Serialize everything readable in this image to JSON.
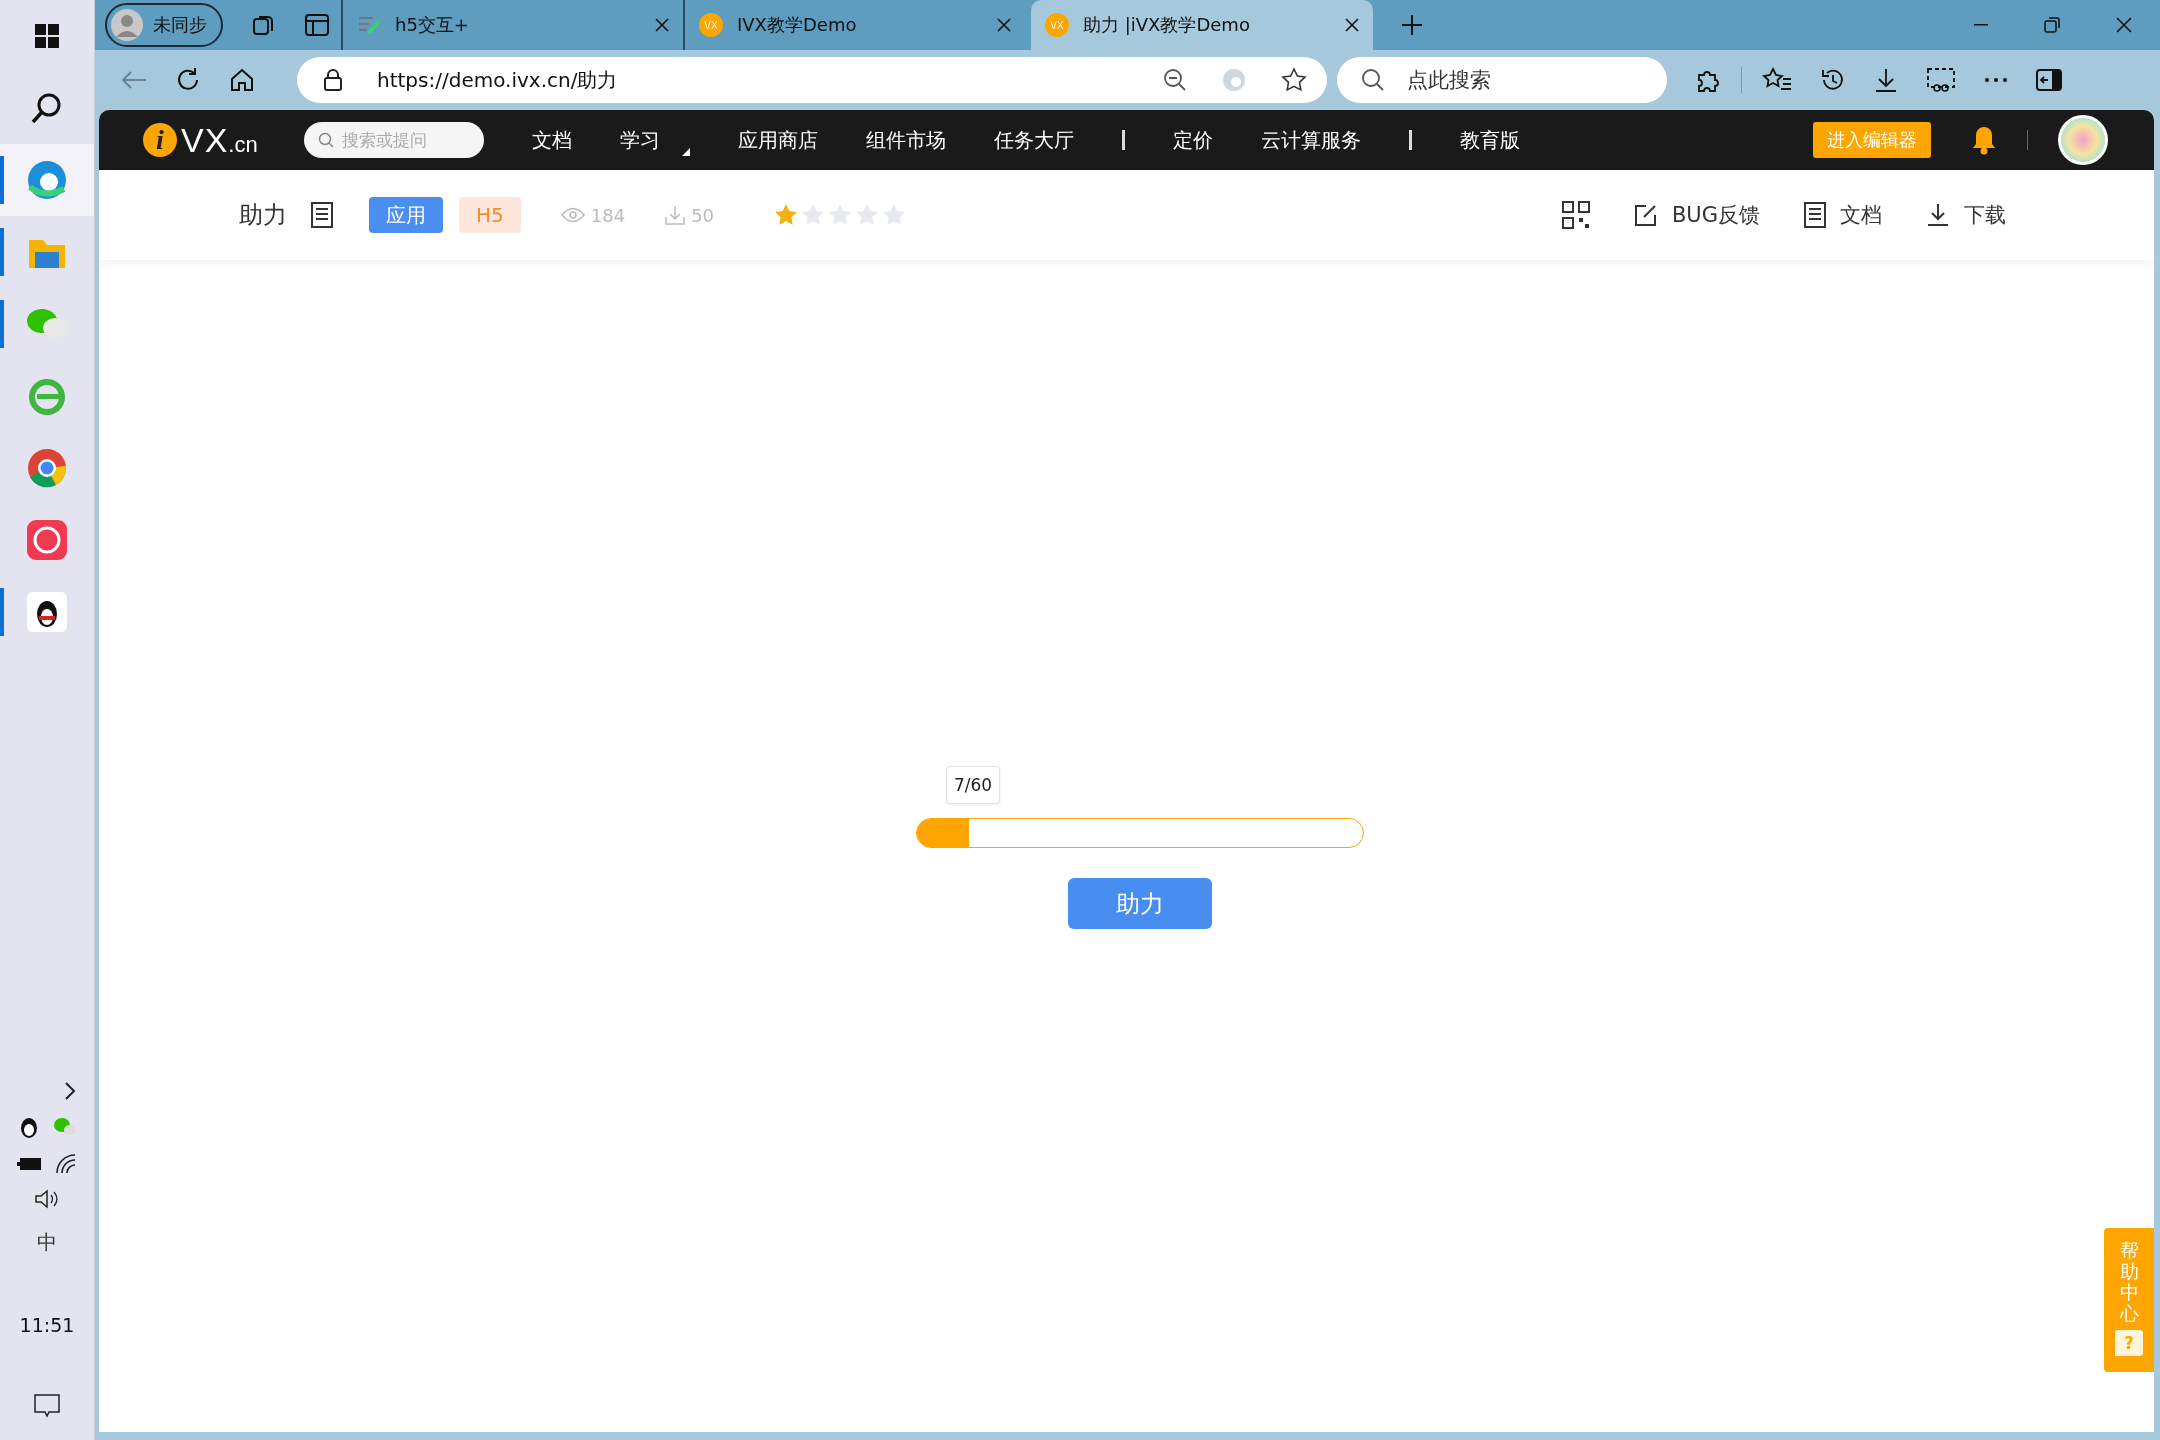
{
  "taskbar": {
    "apps": [
      {
        "running": false,
        "selected": false
      },
      {
        "running": false,
        "selected": false
      },
      {
        "running": true,
        "selected": true
      },
      {
        "running": true,
        "selected": false
      },
      {
        "running": true,
        "selected": false
      },
      {
        "running": false,
        "selected": false
      },
      {
        "running": false,
        "selected": false
      },
      {
        "running": false,
        "selected": false
      },
      {
        "running": true,
        "selected": false
      }
    ],
    "tray": {
      "ime": "中",
      "time": "11:51"
    }
  },
  "browser": {
    "profile": "未同步",
    "tabs": [
      {
        "title": "h5交互+",
        "selected": false
      },
      {
        "title": "IVX教学Demo",
        "favicon": "VX",
        "selected": false
      },
      {
        "title": "助力 |iVX教学Demo",
        "favicon": "VX",
        "selected": true
      }
    ],
    "address": "https://demo.ivx.cn/助力",
    "search_placeholder": "点此搜索"
  },
  "site_nav": {
    "logo": {
      "mark": "i",
      "name": "VX",
      "suffix": ".cn"
    },
    "search_placeholder": "搜索或提问",
    "items": [
      {
        "label": "文档",
        "kind": "link"
      },
      {
        "label": "学习",
        "kind": "menu"
      },
      {
        "label": "应用商店",
        "kind": "link"
      },
      {
        "label": "组件市场",
        "kind": "link"
      },
      {
        "label": "任务大厅",
        "kind": "link"
      },
      {
        "kind": "divider"
      },
      {
        "label": "定价",
        "kind": "link"
      },
      {
        "label": "云计算服务",
        "kind": "link"
      },
      {
        "kind": "divider"
      },
      {
        "label": "教育版",
        "kind": "link"
      }
    ],
    "editor_button": "进入编辑器"
  },
  "app_header": {
    "title": "助力",
    "tags": [
      {
        "label": "应用",
        "color": "#4a8ef0"
      },
      {
        "label": "H5",
        "color": "#ffe6dc"
      }
    ],
    "views": "184",
    "downloads": "50",
    "stars": 1,
    "actions": [
      "BUG反馈",
      "文档",
      "下载"
    ]
  },
  "content": {
    "tooltip": "7/60",
    "level": 0.117,
    "button": "助力"
  },
  "help": {
    "label": "帮助中心",
    "icon": "?"
  }
}
